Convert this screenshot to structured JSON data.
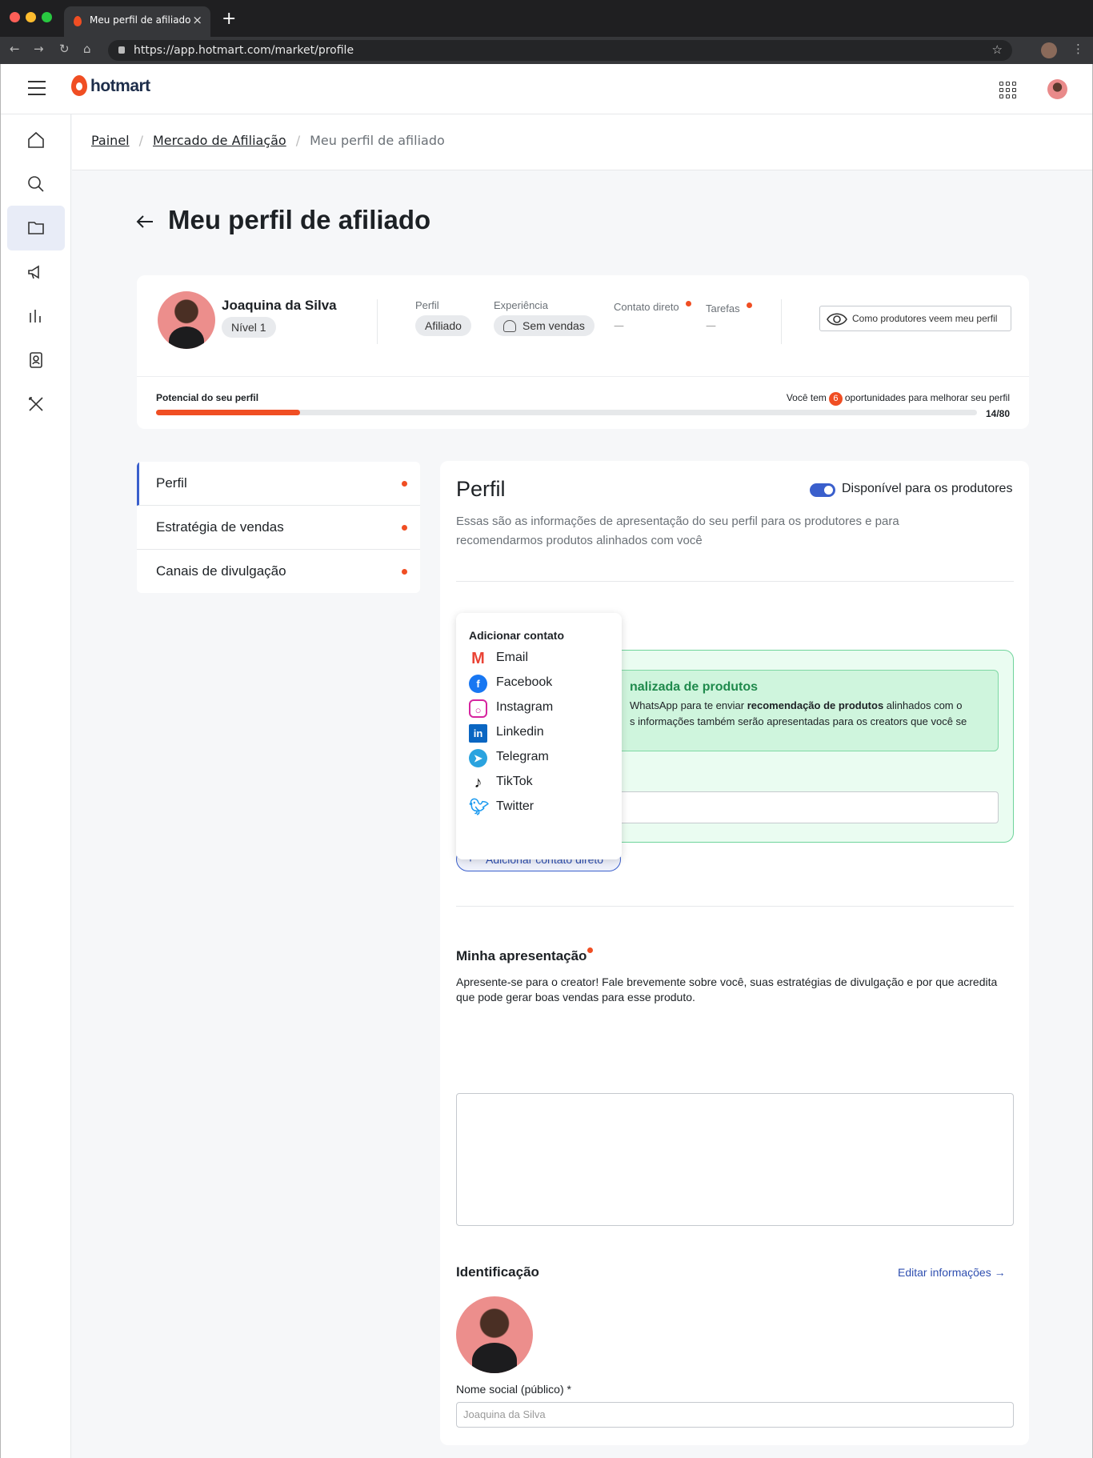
{
  "browser": {
    "tab_title": "Meu perfil de afiliado",
    "url": "https://app.hotmart.com/market/profile",
    "window_colors": [
      "#ff5f57",
      "#febc2e",
      "#28c840"
    ]
  },
  "header": {
    "logo": "hotmart"
  },
  "breadcrumb": {
    "items": [
      "Painel",
      "Mercado de Afiliação"
    ],
    "current": "Meu perfil de afiliado"
  },
  "page": {
    "title": "Meu perfil de afiliado"
  },
  "profile": {
    "name": "Joaquina da Silva",
    "level": "Nível 1",
    "perfil_label": "Perfil",
    "perfil_value": "Afiliado",
    "experiencia_label": "Experiência",
    "experiencia_value": "Sem vendas",
    "contato_label": "Contato direto",
    "contato_value": "—",
    "tarefas_label": "Tarefas",
    "tarefas_value": "—",
    "view_button": "Como produtores veem meu perfil",
    "potential_label": "Potencial do seu perfil",
    "opp_prefix": "Você tem",
    "opp_count": "6",
    "opp_suffix": "oportunidades para melhorar seu perfil",
    "score": "14/80",
    "progress_fraction": 0.175
  },
  "left_nav": {
    "items": [
      "Perfil",
      "Estratégia de vendas",
      "Canais de divulgação"
    ]
  },
  "main": {
    "title": "Perfil",
    "toggle_label": "Disponível para os produtores",
    "toggle_on": true,
    "description": "Essas são as informações de apresentação do seu perfil para os produtores e para recomendarmos produtos alinhados com você",
    "green_title": "nalizada de produtos",
    "green_text_1": "WhatsApp para te enviar ",
    "green_text_bold": "recomendação de produtos",
    "green_text_2": " alinhados com o",
    "green_text_3": "s informações também serão apresentadas para os creators que você se",
    "add_contact_button": "Adicionar contato direto",
    "presentation_title": "Minha apresentação",
    "presentation_help": "Apresente-se para o creator! Fale brevemente sobre você, suas estratégias de divulgação e por que acredita que pode gerar boas vendas para esse produto.",
    "id_title": "Identificação",
    "edit_link": "Editar informações →",
    "social_name_label": "Nome social (público) *",
    "social_name_placeholder": "Joaquina da Silva"
  },
  "contact_menu": {
    "header": "Adicionar contato",
    "items": [
      {
        "label": "Email",
        "icon": "gmail-icon",
        "color": "#ea4335"
      },
      {
        "label": "Facebook",
        "icon": "facebook-icon",
        "color": "#1877f2"
      },
      {
        "label": "Instagram",
        "icon": "instagram-icon",
        "color": "#d6249f"
      },
      {
        "label": "Linkedin",
        "icon": "linkedin-icon",
        "color": "#0a66c2"
      },
      {
        "label": "Telegram",
        "icon": "telegram-icon",
        "color": "#2aa3df"
      },
      {
        "label": "TikTok",
        "icon": "tiktok-icon",
        "color": "#111111"
      },
      {
        "label": "Twitter",
        "icon": "twitter-icon",
        "color": "#1d9bf0"
      }
    ]
  },
  "colors": {
    "brand": "#f04e23",
    "accent": "#3a5fcc",
    "success": "#1f8a4c"
  }
}
